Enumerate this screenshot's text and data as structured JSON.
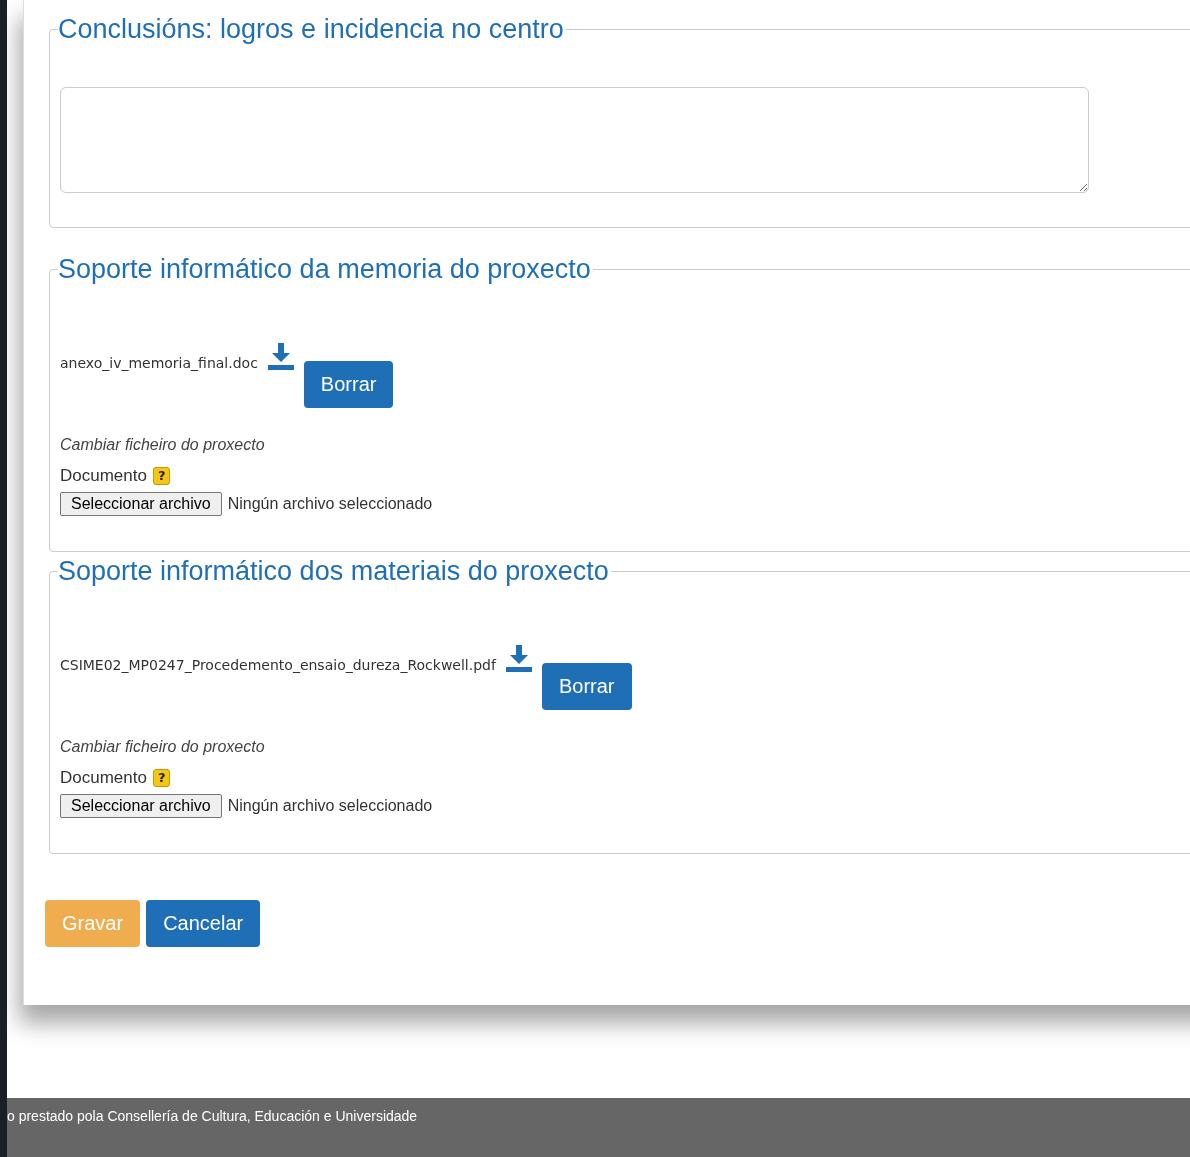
{
  "sections": [
    {
      "kind": "textarea",
      "legend": "Conclusións: logros e incidencia no centro"
    },
    {
      "kind": "file",
      "legend": "Soporte informático da memoria do proxecto",
      "file_name": "anexo_iv_memoria_final.doc",
      "delete_button": "Borrar",
      "change_label": "Cambiar ficheiro do proxecto",
      "field_label": "Documento",
      "help": "?",
      "choose_button": "Seleccionar archivo",
      "no_file": "Ningún archivo seleccionado"
    },
    {
      "kind": "file",
      "legend": "Soporte informático dos materiais do proxecto",
      "file_name": "CSIME02_MP0247_Procedemento_ensaio_dureza_Rockwell.pdf",
      "delete_button": "Borrar",
      "change_label": "Cambiar ficheiro do proxecto",
      "field_label": "Documento",
      "help": "?",
      "choose_button": "Seleccionar archivo",
      "no_file": "Ningún archivo seleccionado"
    }
  ],
  "actions": [
    {
      "kind": "save",
      "label": "Gravar"
    },
    {
      "kind": "cancel",
      "label": "Cancelar"
    }
  ],
  "footer": "o prestado pola Consellería de Cultura, Educación e Universidade"
}
